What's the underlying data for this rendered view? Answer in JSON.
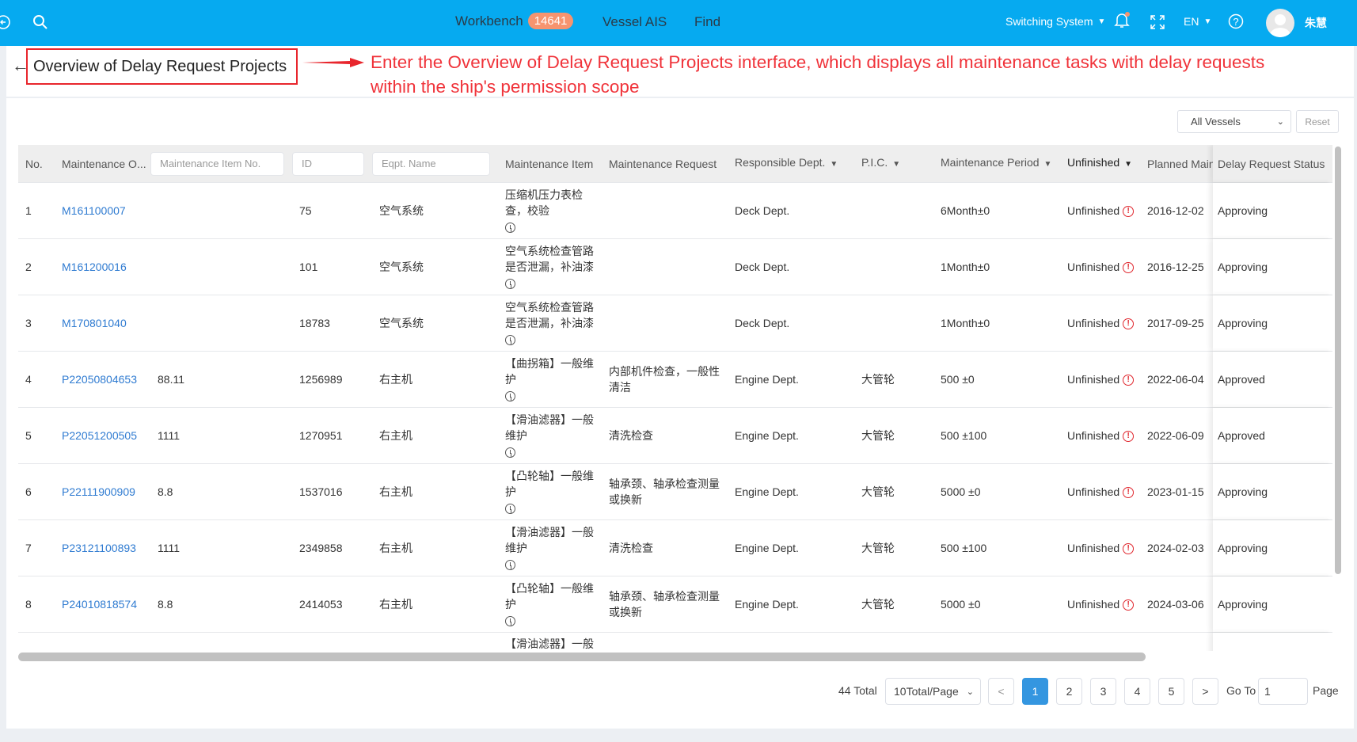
{
  "header": {
    "nav": [
      {
        "label": "Workbench",
        "badge": "14641"
      },
      {
        "label": "Vessel AIS"
      },
      {
        "label": "Find"
      }
    ],
    "switch_system": "Switching System",
    "language": "EN",
    "user_name": "朱慧",
    "colors": {
      "bar": "#06aaf0",
      "badge": "#f7946f"
    }
  },
  "page": {
    "title": "Overview of Delay Request Projects",
    "annotation": [
      "Enter the Overview of Delay Request Projects interface, which displays all maintenance tasks with delay requests",
      "within the ship's permission scope"
    ]
  },
  "filters": {
    "vessel_select": "All Vessels",
    "reset": "Reset"
  },
  "table": {
    "headers": {
      "no": "No.",
      "order": "Maintenance O...",
      "item_no_placeholder": "Maintenance Item No.",
      "id_placeholder": "ID",
      "eqpt_placeholder": "Eqpt. Name",
      "item": "Maintenance Item",
      "request": "Maintenance Request",
      "dept": "Responsible Dept.",
      "pic": "P.I.C.",
      "period": "Maintenance Period",
      "status": "Unfinished",
      "planned": "Planned Maintenance",
      "delay_status": "Delay Request Status"
    },
    "rows": [
      {
        "no": "1",
        "order": "M161100007",
        "item_no": "",
        "id": "75",
        "eqpt": "空气系统",
        "item": "压缩机压力表检查，校验",
        "request": "",
        "dept": "Deck Dept.",
        "pic": "",
        "period": "6Month±0",
        "status": "Unfinished",
        "planned": "2016-12-02",
        "delay_status": "Approving"
      },
      {
        "no": "2",
        "order": "M161200016",
        "item_no": "",
        "id": "101",
        "eqpt": "空气系统",
        "item": "空气系统检查管路是否泄漏，补油漆",
        "request": "",
        "dept": "Deck Dept.",
        "pic": "",
        "period": "1Month±0",
        "status": "Unfinished",
        "planned": "2016-12-25",
        "delay_status": "Approving"
      },
      {
        "no": "3",
        "order": "M170801040",
        "item_no": "",
        "id": "18783",
        "eqpt": "空气系统",
        "item": "空气系统检查管路是否泄漏，补油漆",
        "request": "",
        "dept": "Deck Dept.",
        "pic": "",
        "period": "1Month±0",
        "status": "Unfinished",
        "planned": "2017-09-25",
        "delay_status": "Approving"
      },
      {
        "no": "4",
        "order": "P22050804653",
        "item_no": "88.11",
        "id": "1256989",
        "eqpt": "右主机",
        "item": "【曲拐箱】一般维护",
        "request": "内部机件检查，一般性清洁",
        "dept": "Engine Dept.",
        "pic": "大管轮",
        "period": "500 ±0",
        "status": "Unfinished",
        "planned": "2022-06-04",
        "delay_status": "Approved"
      },
      {
        "no": "5",
        "order": "P22051200505",
        "item_no": "1111",
        "id": "1270951",
        "eqpt": "右主机",
        "item": "【滑油滤器】一般维护",
        "request": "清洗检查",
        "dept": "Engine Dept.",
        "pic": "大管轮",
        "period": "500 ±100",
        "status": "Unfinished",
        "planned": "2022-06-09",
        "delay_status": "Approved"
      },
      {
        "no": "6",
        "order": "P22111900909",
        "item_no": "8.8",
        "id": "1537016",
        "eqpt": "右主机",
        "item": "【凸轮轴】一般维护",
        "request": "轴承颈、轴承检查测量或换新",
        "dept": "Engine Dept.",
        "pic": "大管轮",
        "period": "5000 ±0",
        "status": "Unfinished",
        "planned": "2023-01-15",
        "delay_status": "Approving"
      },
      {
        "no": "7",
        "order": "P23121100893",
        "item_no": "1111",
        "id": "2349858",
        "eqpt": "右主机",
        "item": "【滑油滤器】一般维护",
        "request": "清洗检查",
        "dept": "Engine Dept.",
        "pic": "大管轮",
        "period": "500 ±100",
        "status": "Unfinished",
        "planned": "2024-02-03",
        "delay_status": "Approving"
      },
      {
        "no": "8",
        "order": "P24010818574",
        "item_no": "8.8",
        "id": "2414053",
        "eqpt": "右主机",
        "item": "【凸轮轴】一般维护",
        "request": "轴承颈、轴承检查测量或换新",
        "dept": "Engine Dept.",
        "pic": "大管轮",
        "period": "5000 ±0",
        "status": "Unfinished",
        "planned": "2024-03-06",
        "delay_status": "Approving"
      },
      {
        "no": "",
        "order": "",
        "item_no": "",
        "id": "",
        "eqpt": "",
        "item": "【滑油滤器】一般",
        "request": "",
        "dept": "",
        "pic": "",
        "period": "",
        "status": "",
        "planned": "",
        "delay_status": ""
      }
    ]
  },
  "pagination": {
    "total": "44 Total",
    "page_size": "10Total/Page",
    "prev": "<",
    "next": ">",
    "pages": [
      "1",
      "2",
      "3",
      "4",
      "5"
    ],
    "current": "1",
    "goto_label": "Go To",
    "goto_value": "1",
    "page_label": "Page"
  }
}
